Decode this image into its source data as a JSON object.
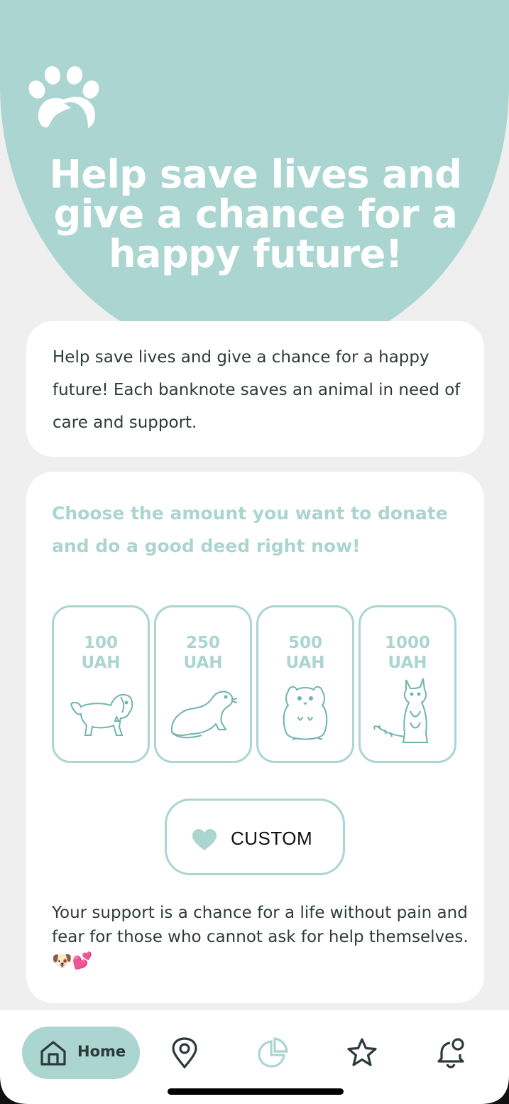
{
  "colors": {
    "accent": "#abd5d1",
    "background": "#efefef",
    "card": "#ffffff",
    "text": "#2f3b3a"
  },
  "hero": {
    "logo_icon": "paw-heart-icon",
    "headline": "Help save lives and give a chance for a happy future!"
  },
  "intro": {
    "text": "Help save lives and give a chance for a happy future! Each banknote saves an animal in need of care and support."
  },
  "donate": {
    "title": "Choose the amount you want to donate and do a good deed right now!",
    "amounts": [
      {
        "value": "100",
        "currency": "UAH",
        "illustration": "dog"
      },
      {
        "value": "250",
        "currency": "UAH",
        "illustration": "ferret"
      },
      {
        "value": "500",
        "currency": "UAH",
        "illustration": "hamster"
      },
      {
        "value": "1000",
        "currency": "UAH",
        "illustration": "cat"
      }
    ],
    "custom_label": "CUSTOM",
    "custom_icon": "heart-icon",
    "support_text": "Your support is a chance for a life without pain and fear for those who cannot ask for help themselves. 🐶💕"
  },
  "tabbar": {
    "home_label": "Home",
    "tabs": [
      "home",
      "location",
      "statistics",
      "favorites",
      "notifications"
    ],
    "active": "home"
  }
}
